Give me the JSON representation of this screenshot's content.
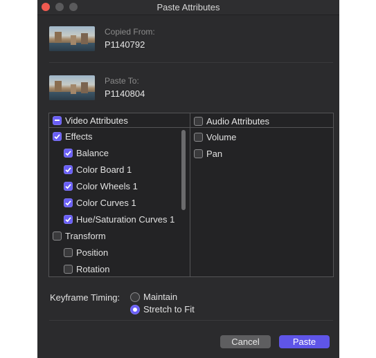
{
  "window": {
    "title": "Paste Attributes"
  },
  "copied_from": {
    "label": "Copied From:",
    "value": "P1140792"
  },
  "paste_to": {
    "label": "Paste To:",
    "value": "P1140804"
  },
  "video_attributes": {
    "header": "Video Attributes",
    "header_state": "mixed",
    "items": [
      {
        "label": "Effects",
        "checked": true,
        "level": 0
      },
      {
        "label": "Balance",
        "checked": true,
        "level": 1
      },
      {
        "label": "Color Board 1",
        "checked": true,
        "level": 1
      },
      {
        "label": "Color Wheels 1",
        "checked": true,
        "level": 1
      },
      {
        "label": "Color Curves 1",
        "checked": true,
        "level": 1
      },
      {
        "label": "Hue/Saturation Curves 1",
        "checked": true,
        "level": 1
      },
      {
        "label": "Transform",
        "checked": false,
        "level": 0
      },
      {
        "label": "Position",
        "checked": false,
        "level": 1
      },
      {
        "label": "Rotation",
        "checked": false,
        "level": 1
      }
    ]
  },
  "audio_attributes": {
    "header": "Audio Attributes",
    "header_checked": false,
    "items": [
      {
        "label": "Volume",
        "checked": false
      },
      {
        "label": "Pan",
        "checked": false
      }
    ]
  },
  "keyframe_timing": {
    "label": "Keyframe Timing:",
    "options": [
      {
        "label": "Maintain",
        "selected": false
      },
      {
        "label": "Stretch to Fit",
        "selected": true
      }
    ]
  },
  "buttons": {
    "cancel": "Cancel",
    "paste": "Paste"
  },
  "colors": {
    "accent": "#6a5ff5",
    "close_button": "#f05a50",
    "background": "#2b2b2d"
  }
}
